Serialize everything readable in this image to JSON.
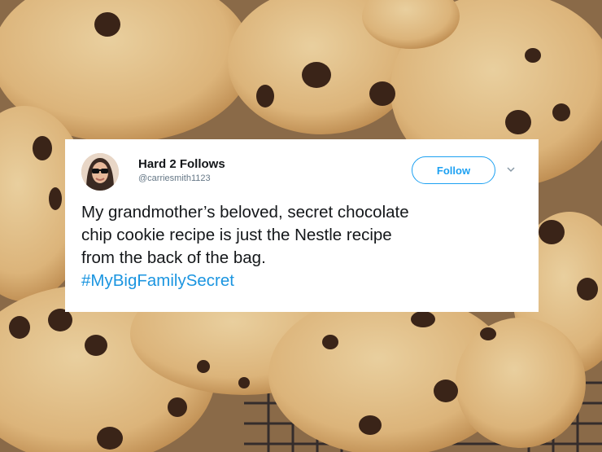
{
  "tweet": {
    "display_name": "Hard 2 Follows",
    "handle": "@carriesmith1123",
    "follow_label": "Follow",
    "text_line1": "My grandmother’s  beloved, secret chocolate",
    "text_line2": "chip cookie recipe is just the Nestle recipe",
    "text_line3": "from the back of the bag.",
    "hashtag": "#MyBigFamilySecret"
  },
  "icons": {
    "avatar": "profile-avatar",
    "menu": "chevron-down-icon"
  },
  "colors": {
    "accent": "#1da1f2",
    "hashtag": "#1b95e0",
    "text": "#14171a",
    "secondary": "#657786"
  }
}
